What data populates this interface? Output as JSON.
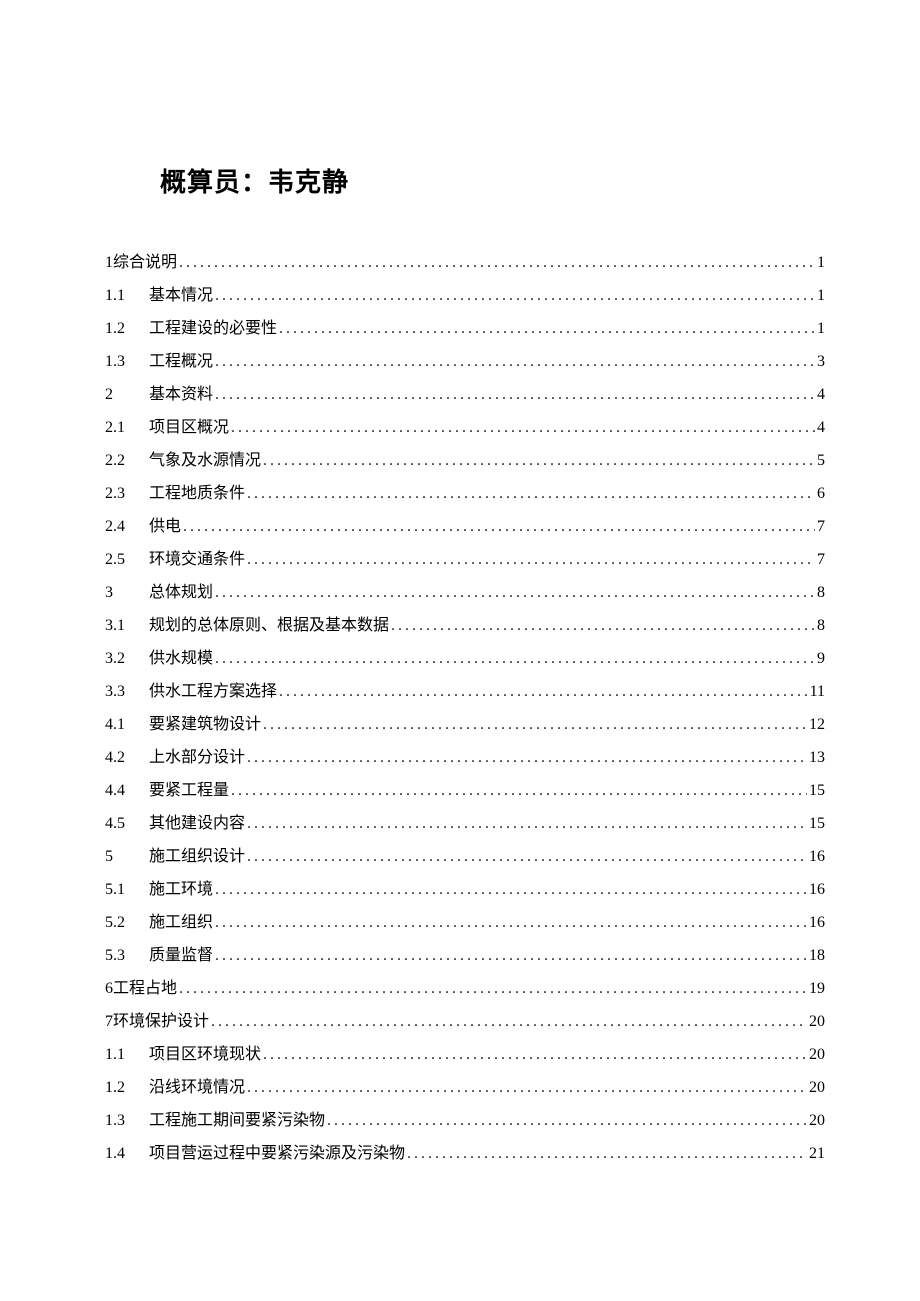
{
  "title": "概算员：韦克静",
  "toc": [
    {
      "num": "1",
      "text": "综合说明",
      "page": "1",
      "indent": false
    },
    {
      "num": "1.1",
      "text": "基本情况",
      "page": "1",
      "indent": true
    },
    {
      "num": "1.2",
      "text": "工程建设的必要性",
      "page": "1",
      "indent": true
    },
    {
      "num": "1.3",
      "text": "工程概况",
      "page": "3",
      "indent": true
    },
    {
      "num": "2",
      "text": "基本资料",
      "page": "4",
      "indent": true
    },
    {
      "num": "2.1",
      "text": "项目区概况",
      "page": "4",
      "indent": true
    },
    {
      "num": "2.2",
      "text": "气象及水源情况",
      "page": "5",
      "indent": true
    },
    {
      "num": "2.3",
      "text": "工程地质条件",
      "page": "6",
      "indent": true
    },
    {
      "num": "2.4",
      "text": "供电",
      "page": "7",
      "indent": true
    },
    {
      "num": "2.5",
      "text": "环境交通条件",
      "page": "7",
      "indent": true
    },
    {
      "num": "3",
      "text": "总体规划",
      "page": "8",
      "indent": true
    },
    {
      "num": "3.1",
      "text": "规划的总体原则、根据及基本数据",
      "page": "8",
      "indent": true
    },
    {
      "num": "3.2",
      "text": "供水规模",
      "page": "9",
      "indent": true
    },
    {
      "num": "3.3",
      "text": "供水工程方案选择",
      "page": "11",
      "indent": true
    },
    {
      "num": "4.1",
      "text": "要紧建筑物设计",
      "page": "12",
      "indent": true
    },
    {
      "num": "4.2",
      "text": "上水部分设计",
      "page": "13",
      "indent": true
    },
    {
      "num": "4.4",
      "text": "要紧工程量",
      "page": "15",
      "indent": true
    },
    {
      "num": "4.5",
      "text": "其他建设内容",
      "page": "15",
      "indent": true
    },
    {
      "num": "5",
      "text": "施工组织设计",
      "page": "16",
      "indent": true
    },
    {
      "num": "5.1",
      "text": "施工环境",
      "page": "16",
      "indent": true
    },
    {
      "num": "5.2",
      "text": "施工组织",
      "page": "16",
      "indent": true
    },
    {
      "num": "5.3",
      "text": "质量监督",
      "page": "18",
      "indent": true
    },
    {
      "num": "6",
      "text": "工程占地",
      "page": "19",
      "indent": false
    },
    {
      "num": "7",
      "text": "环境保护设计",
      "page": "20",
      "indent": false
    },
    {
      "num": "1.1",
      "text": "项目区环境现状",
      "page": "20",
      "indent": true
    },
    {
      "num": "1.2",
      "text": "沿线环境情况",
      "page": "20",
      "indent": true
    },
    {
      "num": "1.3",
      "text": "工程施工期间要紧污染物",
      "page": "20",
      "indent": true
    },
    {
      "num": "1.4",
      "text": "项目营运过程中要紧污染源及污染物",
      "page": "21",
      "indent": true
    }
  ]
}
